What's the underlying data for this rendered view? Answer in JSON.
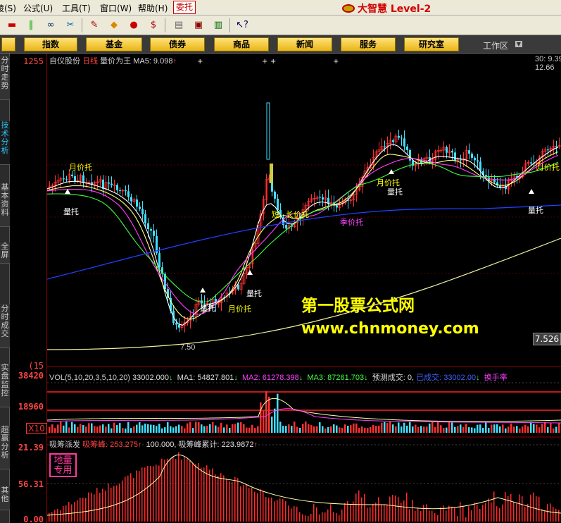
{
  "menubar": {
    "items": [
      {
        "label": "绫(S)",
        "id": "s"
      },
      {
        "label": "公式(U)",
        "id": "u"
      },
      {
        "label": "工具(T)",
        "id": "t"
      },
      {
        "label": "窗口(W)",
        "id": "w"
      },
      {
        "label": "帮助(H)",
        "id": "h"
      }
    ],
    "highlight": "委托",
    "brand": "大智慧 Level-2"
  },
  "toolbar": {
    "icons": [
      "chart-bars-icon",
      "binoculars-icon",
      "tools-icon",
      "pen-icon",
      "diamond-icon",
      "flag-icon",
      "dollar-icon",
      "clipboard-icon",
      "window-icon",
      "book-icon",
      "help-cursor-icon"
    ]
  },
  "nav": {
    "buttons": [
      "指数",
      "基金",
      "债券",
      "商品",
      "新闻",
      "服务",
      "研究室"
    ],
    "workarea": "工作区"
  },
  "sidebar": {
    "tabs": [
      {
        "label": "分时走势",
        "active": false
      },
      {
        "label": "技术分析",
        "active": true
      },
      {
        "label": "基本资料",
        "active": false
      },
      {
        "label": "全屏",
        "active": false
      },
      {
        "label": "分时成交",
        "active": false
      },
      {
        "label": "实盘监控",
        "active": false
      },
      {
        "label": "超赢分析",
        "active": false
      },
      {
        "label": "其他",
        "active": false
      }
    ]
  },
  "main_chart": {
    "stock": "自仪股份",
    "period": "日线",
    "indicator": "量价为王",
    "ma5": "MA5: 9.098",
    "right_top_1": "30: 9.39",
    "right_top_2": "12.66",
    "y_top": "1255",
    "y_bottom": "(15",
    "low_label": "7.50",
    "current_price": "7.526",
    "annotations": [
      {
        "text": "量托",
        "color": "#ffffff"
      },
      {
        "text": "月价托",
        "color": "#ffff00"
      },
      {
        "text": "量托",
        "color": "#ffffff"
      },
      {
        "text": "月价托",
        "color": "#ffff00"
      },
      {
        "text": "量托",
        "color": "#ffffff"
      },
      {
        "text": "短",
        "color": "#ffff00"
      },
      {
        "text": "长价托",
        "color": "#ffff00"
      },
      {
        "text": "季价托",
        "color": "#ff44ff"
      },
      {
        "text": "月价托",
        "color": "#ffff00"
      },
      {
        "text": "量托",
        "color": "#ffffff"
      },
      {
        "text": "月价托",
        "color": "#ffff00"
      },
      {
        "text": "量托",
        "color": "#ffffff"
      }
    ]
  },
  "watermark": {
    "title": "第一股票公式网",
    "url": "www.chnmoney.com"
  },
  "volume_panel": {
    "header": "VOL(5,10,20,3,5,10,20)",
    "value": "33002.000",
    "ma1": "MA1: 54827.801",
    "ma2": "MA2: 61278.398",
    "ma3": "MA3: 87261.703",
    "forecast": "预测成交: 0,",
    "done": "已成交: 33002.00",
    "turnover": "换手率",
    "y1": "38420",
    "y2": "18960",
    "unit": "X10"
  },
  "chip_panel": {
    "title": "吸筹派发",
    "peak": "吸筹峰: 253.275",
    "value": "100.000,",
    "cumulative": "吸筹峰累计: 223.9872",
    "y1": "21.39",
    "y2": "56.31",
    "y3": "0.00",
    "badge_line1": "地量",
    "badge_line2": "专用"
  },
  "colors": {
    "up": "#ff3030",
    "down": "#40e0ff",
    "ma_white": "#ffffff",
    "ma_yellow": "#ffff80",
    "ma_magenta": "#ff40ff",
    "ma_green": "#40ff40",
    "ma_blue": "#2040ff",
    "ma_long": "#f0f0a0"
  }
}
